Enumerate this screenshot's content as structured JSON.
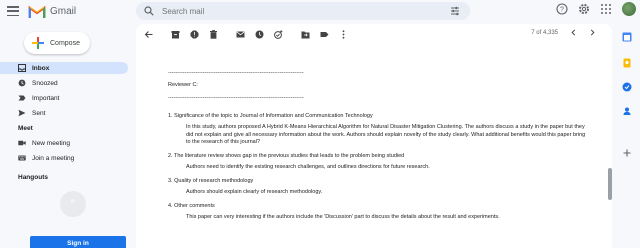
{
  "app": {
    "logo_text": "Gmail"
  },
  "search": {
    "placeholder": "Search mail"
  },
  "sidebar": {
    "compose_label": "Compose",
    "items": [
      {
        "label": "Inbox",
        "icon": "inbox-icon"
      },
      {
        "label": "Snoozed",
        "icon": "clock-icon"
      },
      {
        "label": "Important",
        "icon": "important-icon"
      },
      {
        "label": "Sent",
        "icon": "send-icon"
      }
    ],
    "meet_title": "Meet",
    "meet_items": [
      {
        "label": "New meeting",
        "icon": "video-icon"
      },
      {
        "label": "Join a meeting",
        "icon": "keyboard-icon"
      }
    ],
    "hangouts_title": "Hangouts",
    "signin_label": "Sign in"
  },
  "pager": {
    "text": "7 of 4,335"
  },
  "email": {
    "dashes_top": "--------------------------------------------------------------------------",
    "reviewer": "Reviewer C:",
    "dashes_bottom": "--------------------------------------------------------------------------",
    "items": [
      {
        "question": "1. Significance of the topic to Journal of Information and Communication Technology",
        "answer": "In this study, authors proposed A Hybrid K-Means Hierarchical Algorithm for Natural Disaster Mitigation Clustering. The authors discuss a study in the paper but they did not explain and give all necessary information about the work. Authors should explain novelty of the study clearly. What additional benefits would this paper bring to the research of this journal?"
      },
      {
        "question": "2. The literature review shows gap in the previous studies that leads to the problem being studied",
        "answer": "Authors need to identify the existing research challenges, and outlines directions for future research."
      },
      {
        "question": "3. Quality of research methodology",
        "answer": "Authors should explain clearly of research methodology."
      },
      {
        "question": "4. Other comments",
        "answer": "This paper can very interesting if the authors include the 'Discussion' part to discuss the details about the result and experiments."
      }
    ]
  },
  "colors": {
    "accent": "#1a73e8",
    "active_nav": "#d3e3fd",
    "background": "#f6f8fc"
  }
}
